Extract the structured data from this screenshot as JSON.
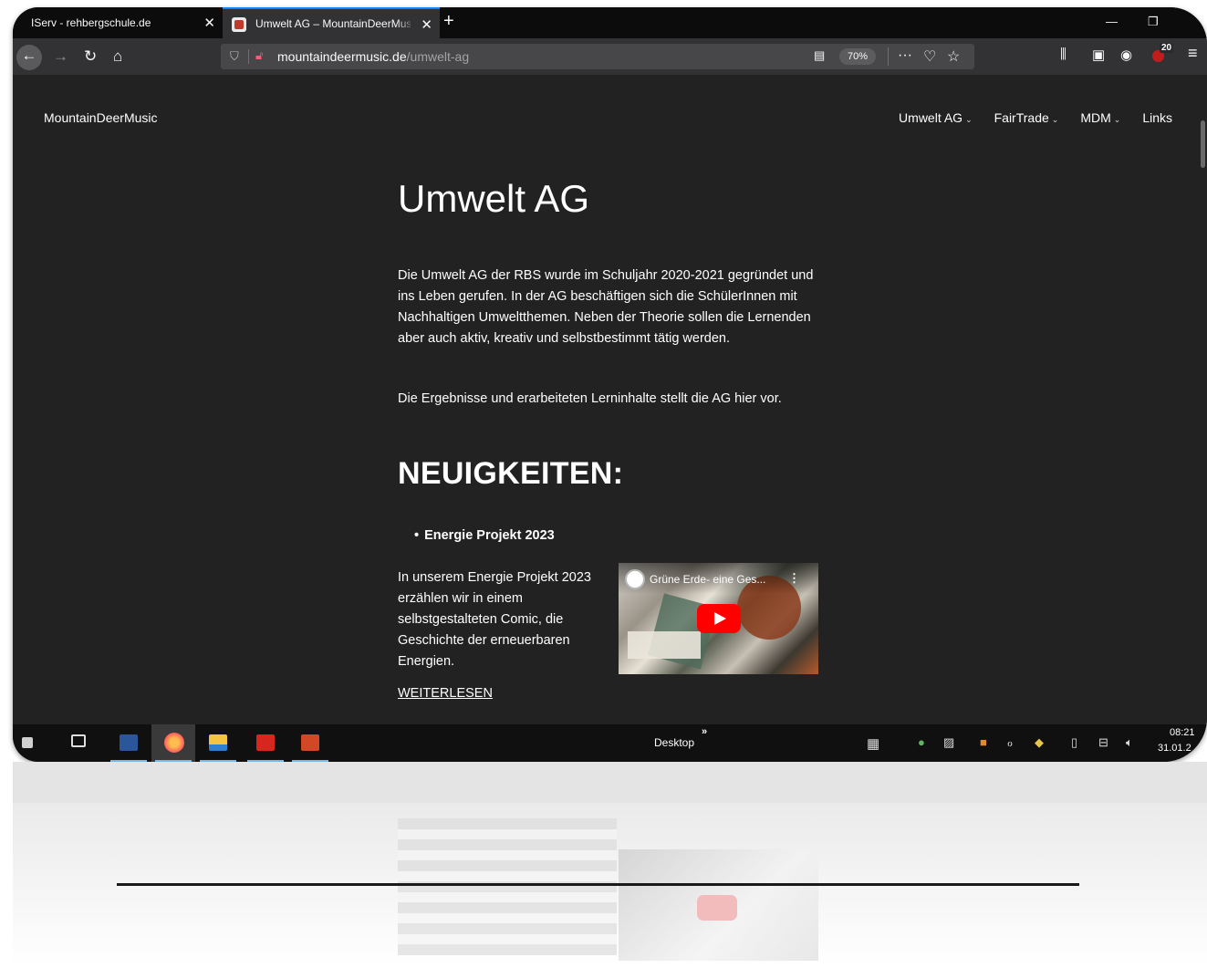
{
  "browser": {
    "tabs": [
      {
        "title": "IServ - rehbergschule.de",
        "active": false
      },
      {
        "title": "Umwelt AG – MountainDeerMusic",
        "active": true
      }
    ],
    "url": {
      "host": "mountaindeermusic.de",
      "path": "/umwelt-ag"
    },
    "zoom": "70%",
    "extension_badge": "20"
  },
  "site": {
    "title": "MountainDeerMusic",
    "menu": [
      "Umwelt AG",
      "FairTrade",
      "MDM",
      "Links"
    ]
  },
  "page": {
    "heading": "Umwelt AG",
    "intro": "Die Umwelt AG der RBS wurde im Schuljahr 2020-2021 gegründet und ins Leben gerufen. In der AG beschäftigen sich die SchülerInnen mit Nachhaltigen Umweltthemen. Neben der Theorie sollen die Lernenden aber auch aktiv, kreativ und selbstbestimmt tätig werden.",
    "results": "Die Ergebnisse und erarbeiteten Lerninhalte stellt die AG hier vor.",
    "news_heading": "NEUIGKEITEN:",
    "news_item": "Energie Projekt 2023",
    "news_text": "In unserem Energie Projekt 2023 erzählen wir in einem selbstgestalteten Comic, die Geschichte der erneuerbaren Energien.",
    "read_more": "WEITERLESEN",
    "video_title": "Grüne Erde- eine Ges..."
  },
  "taskbar": {
    "desktop_label": "Desktop",
    "time": "08:21",
    "date": "31.01.2"
  },
  "icons": {
    "back": "arrow-left-icon",
    "forward": "arrow-right-icon",
    "reload": "reload-icon",
    "home": "home-icon",
    "library": "library-icon",
    "sidebar": "sidebar-icon",
    "account": "account-icon",
    "menu": "hamburger-icon"
  }
}
